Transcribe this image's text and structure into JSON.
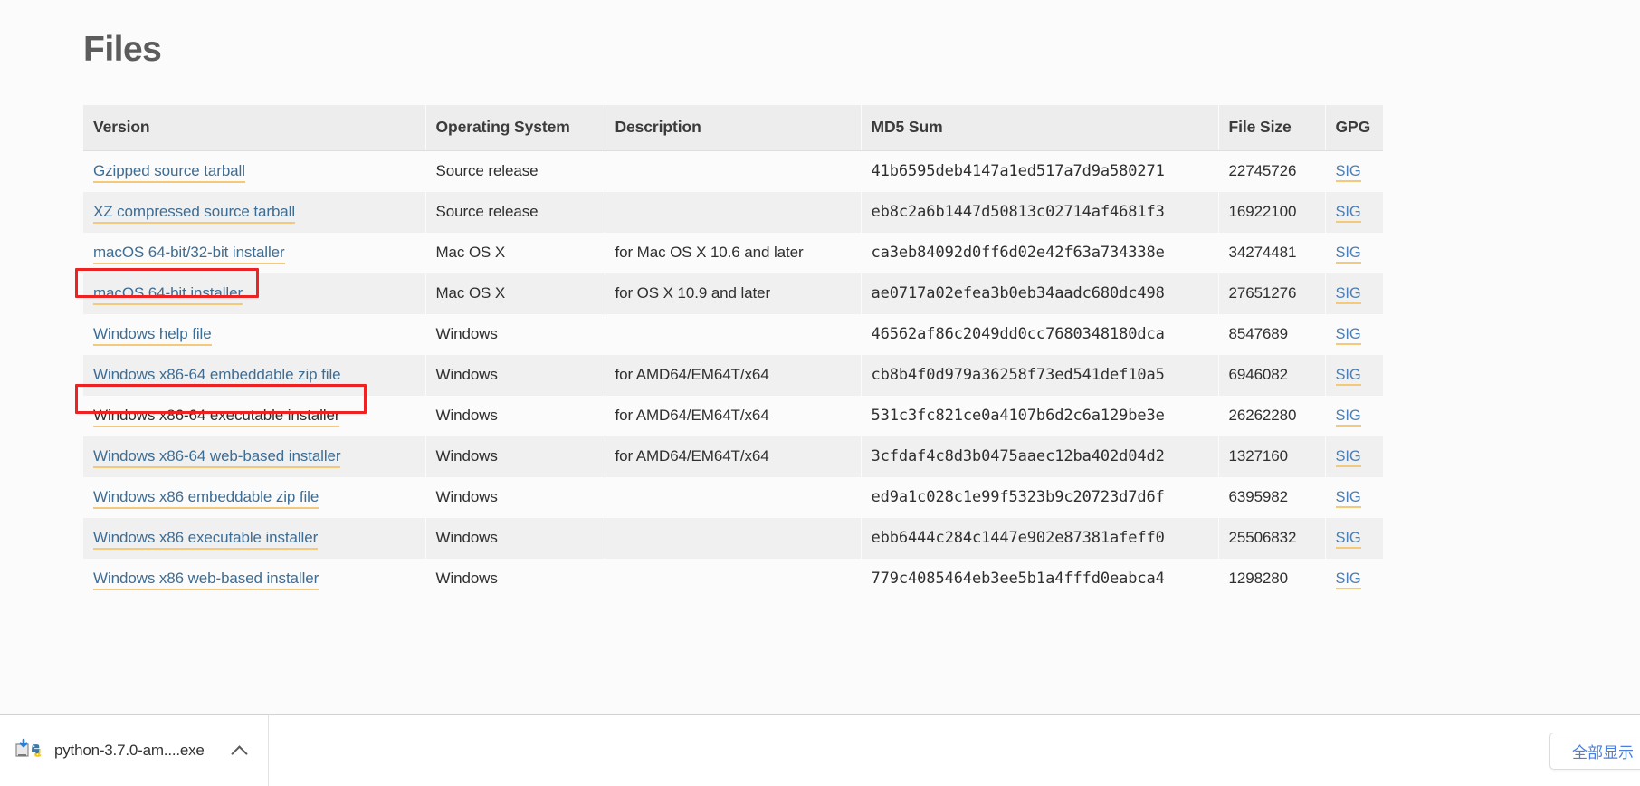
{
  "page": {
    "title": "Files"
  },
  "table": {
    "headers": [
      "Version",
      "Operating System",
      "Description",
      "MD5 Sum",
      "File Size",
      "GPG"
    ],
    "rows": [
      {
        "version": "Gzipped source tarball",
        "version_state": "link",
        "os": "Source release",
        "description": "",
        "md5": "41b6595deb4147a1ed517a7d9a580271",
        "size": "22745726",
        "gpg": "SIG"
      },
      {
        "version": "XZ compressed source tarball",
        "version_state": "link",
        "os": "Source release",
        "description": "",
        "md5": "eb8c2a6b1447d50813c02714af4681f3",
        "size": "16922100",
        "gpg": "SIG"
      },
      {
        "version": "macOS 64-bit/32-bit installer",
        "version_state": "link",
        "os": "Mac OS X",
        "description": "for Mac OS X 10.6 and later",
        "md5": "ca3eb84092d0ff6d02e42f63a734338e",
        "size": "34274481",
        "gpg": "SIG"
      },
      {
        "version": "macOS 64-bit installer",
        "version_state": "link",
        "os": "Mac OS X",
        "description": "for OS X 10.9 and later",
        "md5": "ae0717a02efea3b0eb34aadc680dc498",
        "size": "27651276",
        "gpg": "SIG"
      },
      {
        "version": "Windows help file",
        "version_state": "link",
        "os": "Windows",
        "description": "",
        "md5": "46562af86c2049dd0cc7680348180dca",
        "size": "8547689",
        "gpg": "SIG"
      },
      {
        "version": "Windows x86-64 embeddable zip file",
        "version_state": "link",
        "os": "Windows",
        "description": "for AMD64/EM64T/x64",
        "md5": "cb8b4f0d979a36258f73ed541def10a5",
        "size": "6946082",
        "gpg": "SIG"
      },
      {
        "version": "Windows x86-64 executable installer",
        "version_state": "visited",
        "os": "Windows",
        "description": "for AMD64/EM64T/x64",
        "md5": "531c3fc821ce0a4107b6d2c6a129be3e",
        "size": "26262280",
        "gpg": "SIG"
      },
      {
        "version": "Windows x86-64 web-based installer",
        "version_state": "link",
        "os": "Windows",
        "description": "for AMD64/EM64T/x64",
        "md5": "3cfdaf4c8d3b0475aaec12ba402d04d2",
        "size": "1327160",
        "gpg": "SIG"
      },
      {
        "version": "Windows x86 embeddable zip file",
        "version_state": "link",
        "os": "Windows",
        "description": "",
        "md5": "ed9a1c028c1e99f5323b9c20723d7d6f",
        "size": "6395982",
        "gpg": "SIG"
      },
      {
        "version": "Windows x86 executable installer",
        "version_state": "link",
        "os": "Windows",
        "description": "",
        "md5": "ebb6444c284c1447e902e87381afeff0",
        "size": "25506832",
        "gpg": "SIG"
      },
      {
        "version": "Windows x86 web-based installer",
        "version_state": "link",
        "os": "Windows",
        "description": "",
        "md5": "779c4085464eb3ee5b1a4fffd0eabca4",
        "size": "1298280",
        "gpg": "SIG"
      }
    ]
  },
  "annotations": {
    "highlight_color": "#ee2222",
    "boxes": [
      {
        "target": "macOS 64-bit installer"
      },
      {
        "target": "Windows x86-64 executable installer"
      }
    ]
  },
  "download_shelf": {
    "item_name": "python-3.7.0-am....exe",
    "show_all_label": "全部显示"
  },
  "colors": {
    "link": "#3e6d94",
    "link_underline": "#f5c97a",
    "header_bg": "#ededed",
    "stripe_bg": "#f0f0f0",
    "page_bg": "#fbfbfb",
    "accent_button_text": "#4a7fe0"
  }
}
